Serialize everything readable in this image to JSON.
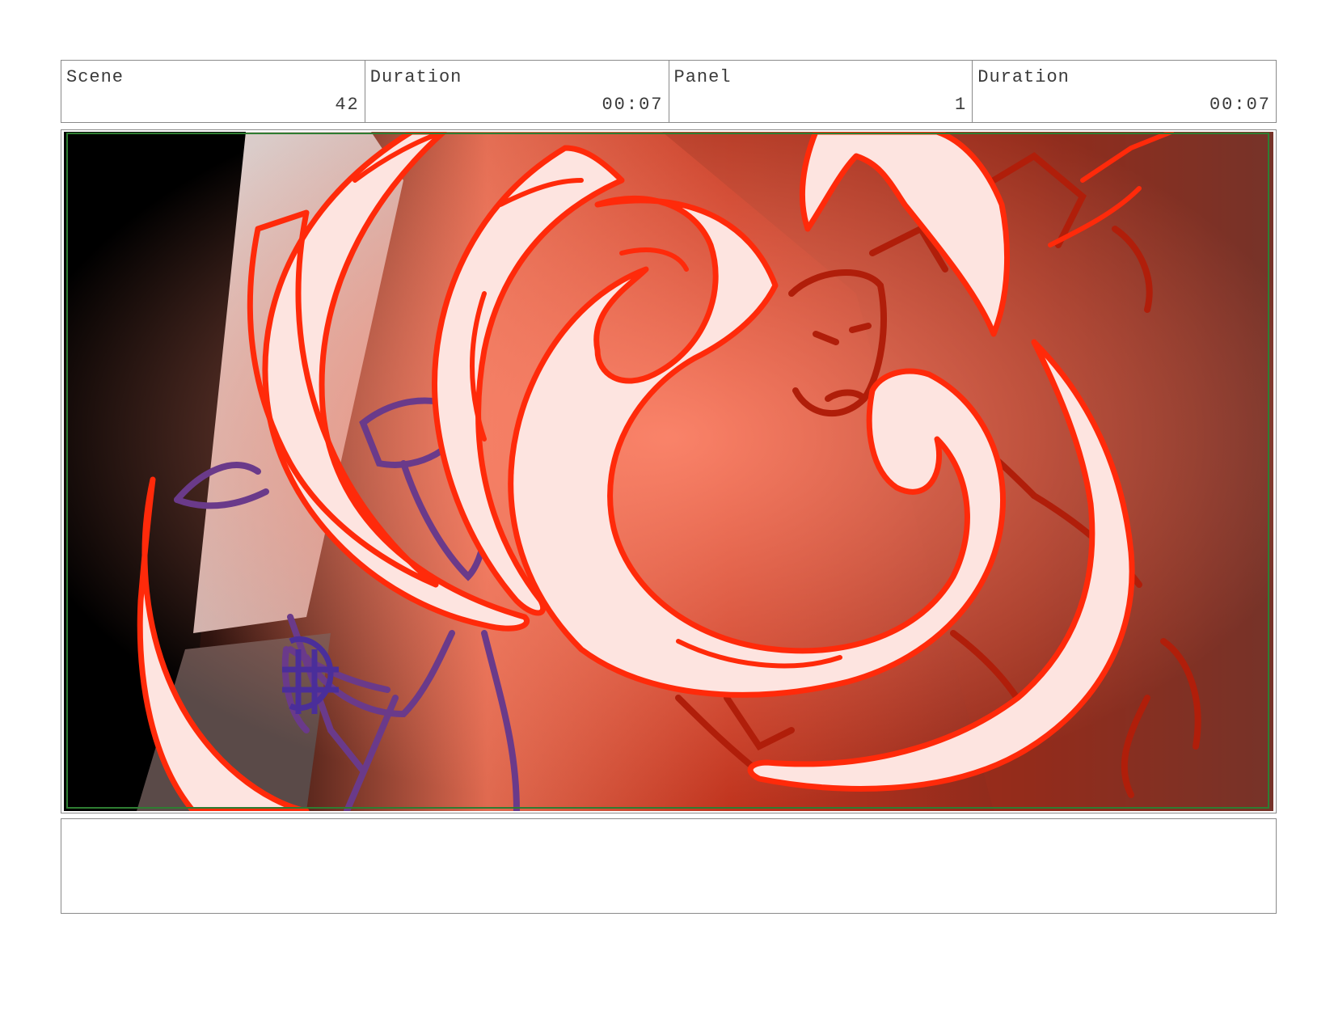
{
  "header": {
    "scene_label": "Scene",
    "scene_value": "42",
    "scene_duration_label": "Duration",
    "scene_duration_value": "00:07",
    "panel_label": "Panel",
    "panel_value": "1",
    "panel_duration_label": "Duration",
    "panel_duration_value": "00:07"
  },
  "panel": {
    "colors": {
      "flame_stroke": "#ff2a0a",
      "flame_fill": "#fde4e0",
      "character_purple": "#6a3a8a",
      "character_red": "#b01e0a",
      "safe_area": "#2e7d32",
      "background_dark": "#000000"
    }
  },
  "notes": {
    "text": ""
  }
}
